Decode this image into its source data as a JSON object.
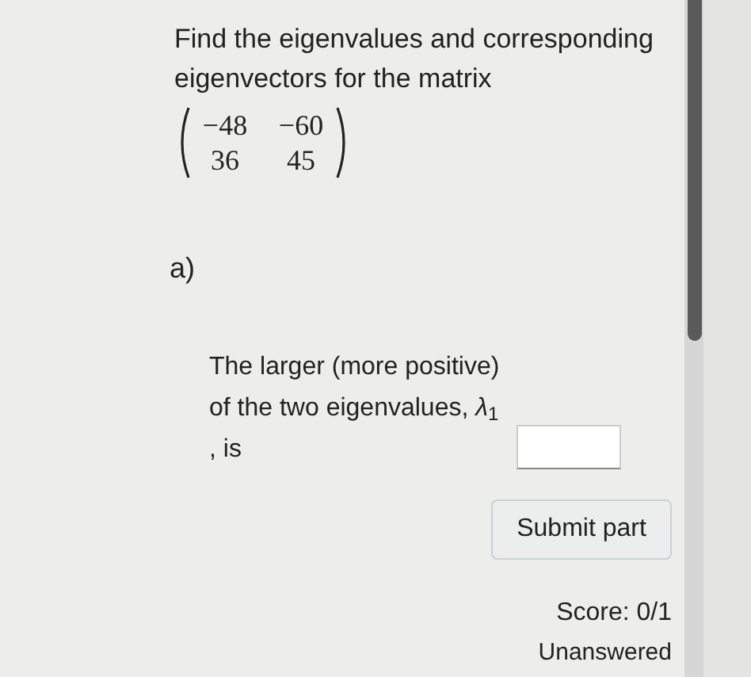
{
  "question": "Find the eigenvalues and corresponding eigenvectors for the matrix",
  "matrix": [
    [
      "−48",
      "−60"
    ],
    [
      "36",
      "45"
    ]
  ],
  "part": {
    "label": "a)",
    "prompt": "The larger (more positive) of the two eigenvalues, *λ*$_{1}$ , is",
    "submit": "Submit part",
    "score": "Score: 0/1",
    "status": "Unanswered"
  }
}
